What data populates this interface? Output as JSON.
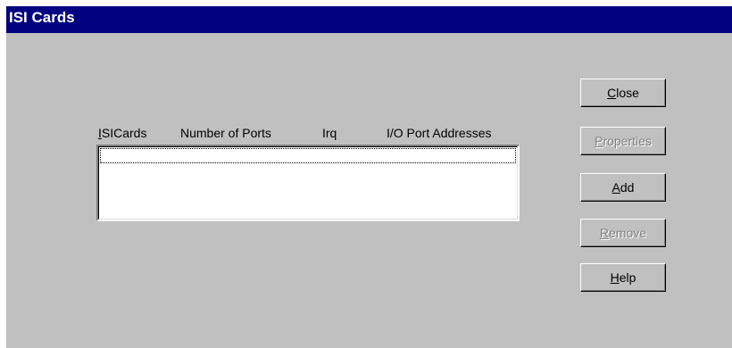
{
  "window": {
    "title": "ISI Cards"
  },
  "list": {
    "columns": [
      {
        "access_key": "I",
        "rest": "SICards"
      },
      {
        "label": "Number of Ports"
      },
      {
        "label": "Irq"
      },
      {
        "label": "I/O Port Addresses"
      }
    ],
    "rows": []
  },
  "buttons": {
    "close": {
      "access_key": "C",
      "rest": "lose",
      "enabled": true
    },
    "properties": {
      "access_key": "P",
      "rest": "roperties",
      "enabled": false
    },
    "add": {
      "access_key": "A",
      "rest": "dd",
      "enabled": true
    },
    "remove": {
      "access_key": "R",
      "rest": "emove",
      "enabled": false
    },
    "help": {
      "access_key": "H",
      "rest": "elp",
      "enabled": true
    }
  },
  "colors": {
    "titlebar": "#000080",
    "dialog_face": "#c0c0c0",
    "disabled_text": "#808080"
  }
}
